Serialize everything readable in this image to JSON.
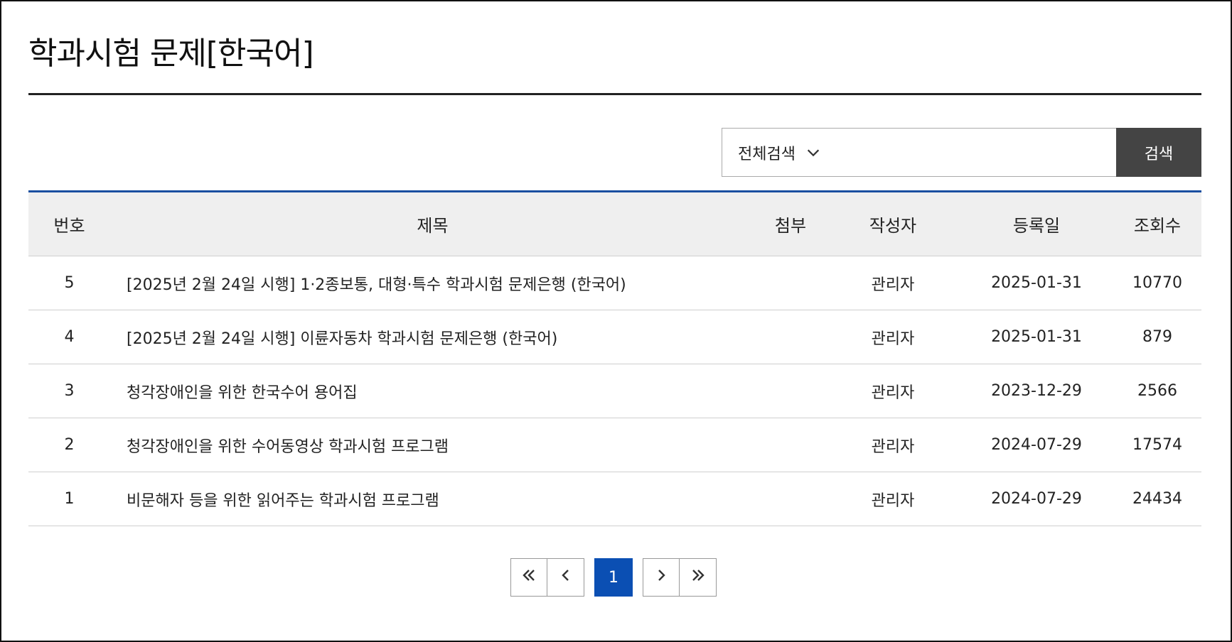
{
  "page": {
    "title": "학과시험 문제[한국어]"
  },
  "search": {
    "scope_label": "전체검색",
    "input_value": "",
    "placeholder": "",
    "button_label": "검색"
  },
  "table": {
    "headers": {
      "no": "번호",
      "title": "제목",
      "attachment": "첨부",
      "author": "작성자",
      "date": "등록일",
      "views": "조회수"
    },
    "rows": [
      {
        "no": "5",
        "title": "[2025년 2월 24일 시행] 1·2종보통, 대형·특수 학과시험 문제은행 (한국어)",
        "author": "관리자",
        "date": "2025-01-31",
        "views": "10770"
      },
      {
        "no": "4",
        "title": "[2025년 2월 24일 시행] 이륜자동차 학과시험 문제은행 (한국어)",
        "author": "관리자",
        "date": "2025-01-31",
        "views": "879"
      },
      {
        "no": "3",
        "title": "청각장애인을 위한 한국수어 용어집",
        "author": "관리자",
        "date": "2023-12-29",
        "views": "2566"
      },
      {
        "no": "2",
        "title": "청각장애인을 위한 수어동영상 학과시험 프로그램",
        "author": "관리자",
        "date": "2024-07-29",
        "views": "17574"
      },
      {
        "no": "1",
        "title": "비문해자 등을 위한 읽어주는 학과시험 프로그램",
        "author": "관리자",
        "date": "2024-07-29",
        "views": "24434"
      }
    ]
  },
  "pagination": {
    "current_page": "1",
    "icons": {
      "first": "double-chevron-left-icon",
      "prev": "chevron-left-icon",
      "next": "chevron-right-icon",
      "last": "double-chevron-right-icon"
    }
  },
  "colors": {
    "accent": "#1a4fa0",
    "current_page_bg": "#0b4fb3",
    "search_button_bg": "#444444",
    "header_bg": "#efefef"
  }
}
